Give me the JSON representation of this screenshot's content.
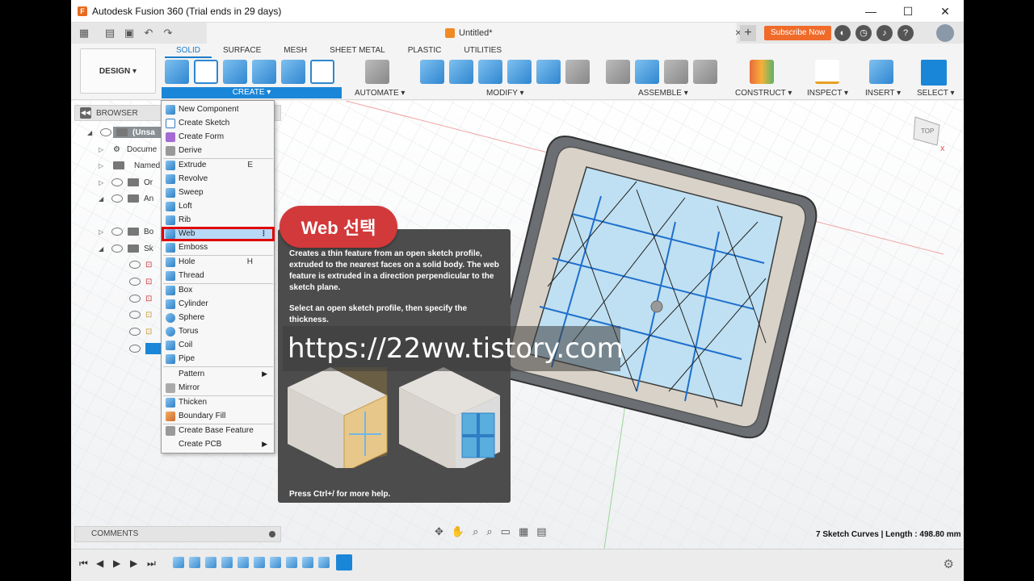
{
  "titlebar": {
    "title": "Autodesk Fusion 360 (Trial ends in 29 days)",
    "minimize": "—",
    "maximize": "☐",
    "close": "✕"
  },
  "appbar": {
    "doc_name": "Untitled*",
    "subscribe": "Subscribe Now",
    "close_tab": "×",
    "new_tab": "+"
  },
  "toolbar": {
    "workspace": "DESIGN ▾",
    "tabs": [
      "SOLID",
      "SURFACE",
      "MESH",
      "SHEET METAL",
      "PLASTIC",
      "UTILITIES"
    ],
    "groups": {
      "create": "CREATE ▾",
      "automate": "AUTOMATE ▾",
      "modify": "MODIFY ▾",
      "assemble": "ASSEMBLE ▾",
      "construct": "CONSTRUCT ▾",
      "inspect": "INSPECT ▾",
      "insert": "INSERT ▾",
      "select": "SELECT ▾"
    }
  },
  "browser": {
    "header": "BROWSER",
    "rows": [
      "(Unsa",
      "Docume",
      "Named",
      "Or",
      "An",
      "Bo",
      "Sk"
    ]
  },
  "menu": {
    "items": [
      {
        "label": "New Component",
        "shortcut": ""
      },
      {
        "label": "Create Sketch",
        "shortcut": ""
      },
      {
        "label": "Create Form",
        "shortcut": ""
      },
      {
        "label": "Derive",
        "shortcut": ""
      },
      {
        "label": "Extrude",
        "shortcut": "E"
      },
      {
        "label": "Revolve",
        "shortcut": ""
      },
      {
        "label": "Sweep",
        "shortcut": ""
      },
      {
        "label": "Loft",
        "shortcut": ""
      },
      {
        "label": "Rib",
        "shortcut": ""
      },
      {
        "label": "Web",
        "shortcut": "⋮"
      },
      {
        "label": "Emboss",
        "shortcut": ""
      },
      {
        "label": "Hole",
        "shortcut": "H"
      },
      {
        "label": "Thread",
        "shortcut": ""
      },
      {
        "label": "Box",
        "shortcut": ""
      },
      {
        "label": "Cylinder",
        "shortcut": ""
      },
      {
        "label": "Sphere",
        "shortcut": ""
      },
      {
        "label": "Torus",
        "shortcut": ""
      },
      {
        "label": "Coil",
        "shortcut": ""
      },
      {
        "label": "Pipe",
        "shortcut": ""
      },
      {
        "label": "Pattern",
        "shortcut": "▶"
      },
      {
        "label": "Mirror",
        "shortcut": ""
      },
      {
        "label": "Thicken",
        "shortcut": ""
      },
      {
        "label": "Boundary Fill",
        "shortcut": ""
      },
      {
        "label": "Create Base Feature",
        "shortcut": ""
      },
      {
        "label": "Create PCB",
        "shortcut": "▶"
      }
    ]
  },
  "tooltip": {
    "badge": "Web 선택",
    "desc": "Creates a thin feature from an open sketch profile, extruded to the nearest faces on a solid body. The web feature is extruded in a direction perpendicular to the sketch plane.",
    "desc2": "Select an open sketch profile, then specify the thickness.",
    "help": "Press Ctrl+/ for more help.",
    "watermark": "https://22ww.tistory.com"
  },
  "bottom": {
    "comments": "COMMENTS",
    "status": "7 Sketch Curves | Length : 498.80 mm",
    "viewcube": "TOP"
  }
}
